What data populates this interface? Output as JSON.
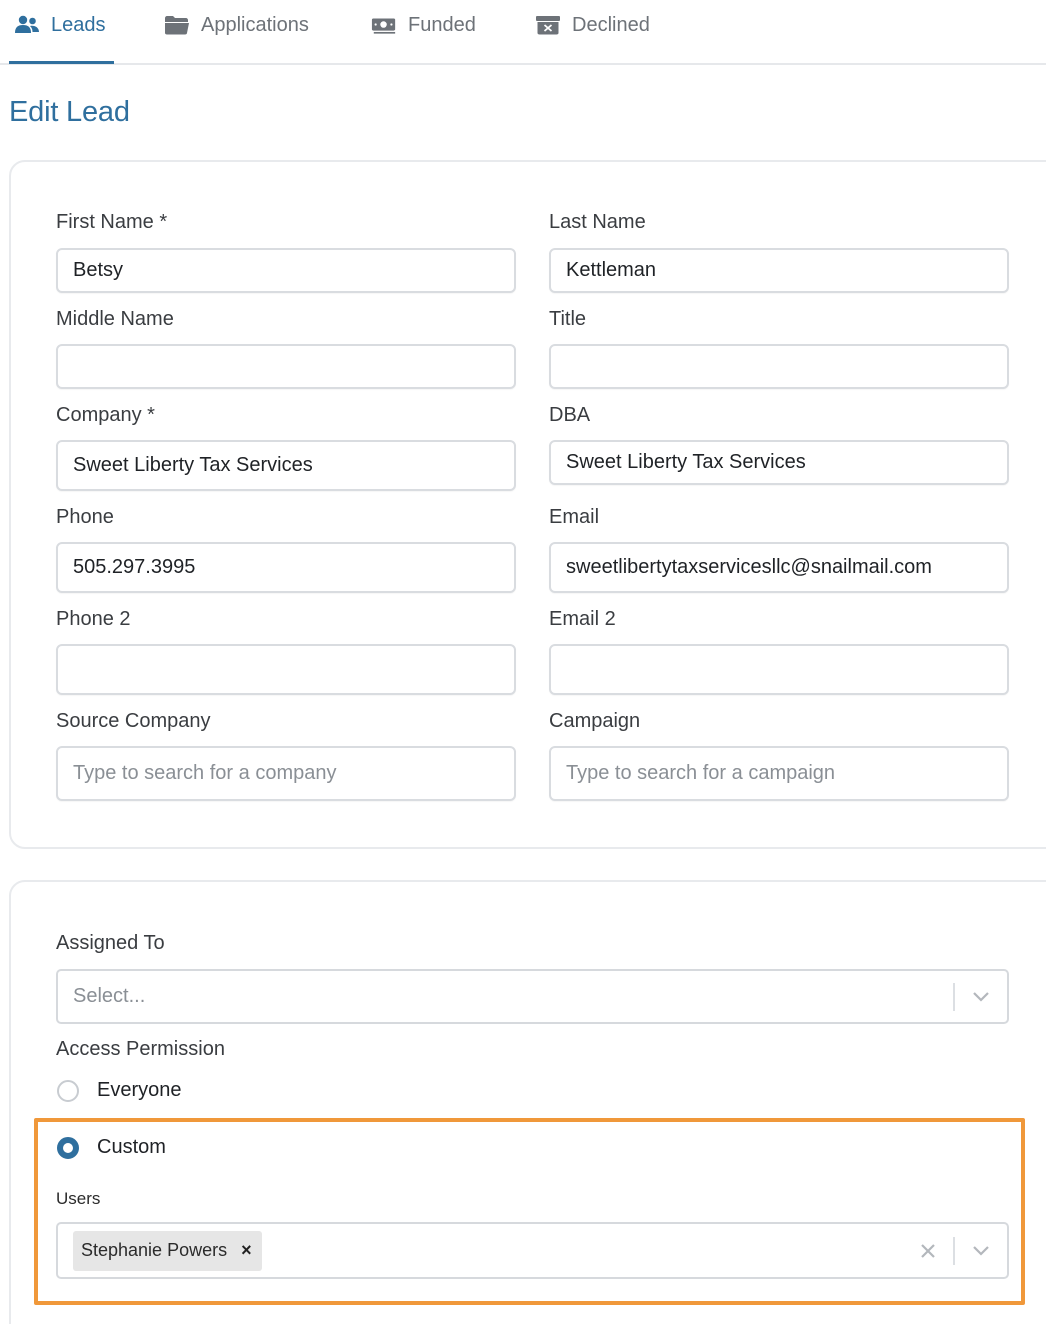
{
  "tabs": [
    {
      "label": "Leads",
      "icon": "users-icon",
      "active": true
    },
    {
      "label": "Applications",
      "icon": "folder-icon"
    },
    {
      "label": "Funded",
      "icon": "money-icon"
    },
    {
      "label": "Declined",
      "icon": "archive-icon"
    }
  ],
  "page_title": "Edit Lead",
  "lead_form": {
    "first_name": {
      "label": "First Name *",
      "value": "Betsy"
    },
    "last_name": {
      "label": "Last Name",
      "value": "Kettleman"
    },
    "middle_name": {
      "label": "Middle Name",
      "value": ""
    },
    "title": {
      "label": "Title",
      "value": ""
    },
    "company": {
      "label": "Company *",
      "value": "Sweet Liberty Tax Services"
    },
    "dba": {
      "label": "DBA",
      "value": "Sweet Liberty Tax Services"
    },
    "phone": {
      "label": "Phone",
      "value": "505.297.3995"
    },
    "email": {
      "label": "Email",
      "value": "sweetlibertytaxservicesllc@snailmail.com"
    },
    "phone2": {
      "label": "Phone 2",
      "value": ""
    },
    "email2": {
      "label": "Email 2",
      "value": ""
    },
    "source_company": {
      "label": "Source Company",
      "placeholder": "Type to search for a company"
    },
    "campaign": {
      "label": "Campaign",
      "placeholder": "Type to search for a campaign"
    }
  },
  "assignment": {
    "assigned_to": {
      "label": "Assigned To",
      "placeholder": "Select..."
    },
    "access_permission": {
      "label": "Access Permission",
      "options": [
        {
          "label": "Everyone",
          "checked": false
        },
        {
          "label": "Custom",
          "checked": true
        }
      ]
    },
    "users": {
      "label": "Users",
      "selected": [
        "Stephanie Powers"
      ],
      "remove_glyph": "×"
    }
  },
  "colors": {
    "accent": "#2f6f9e",
    "highlight": "#f0983a"
  }
}
